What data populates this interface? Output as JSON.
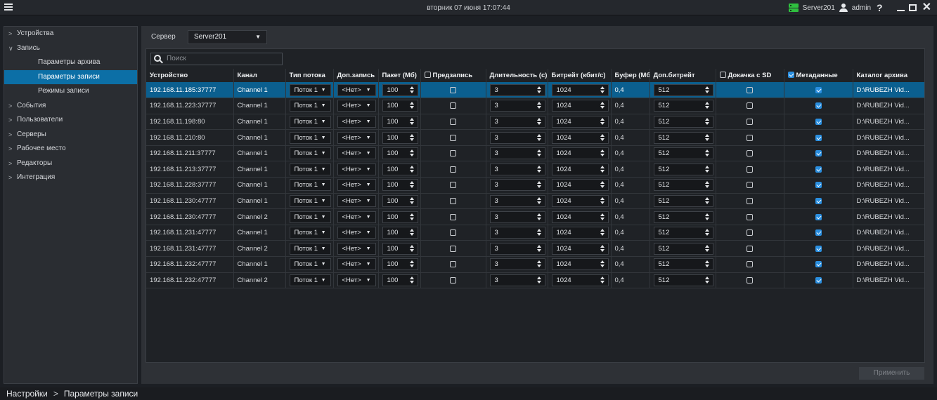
{
  "titlebar": {
    "clock": "вторник 07 июня 17:07:44",
    "server_name": "Server201",
    "user_name": "admin",
    "help_label": "?"
  },
  "sidebar": {
    "items": [
      {
        "label": "Устройства",
        "arrow": ">",
        "level": 0
      },
      {
        "label": "Запись",
        "arrow": "v",
        "level": 0
      },
      {
        "label": "Параметры архива",
        "arrow": "",
        "level": 1
      },
      {
        "label": "Параметры записи",
        "arrow": "",
        "level": 1,
        "selected": true
      },
      {
        "label": "Режимы записи",
        "arrow": "",
        "level": 1
      },
      {
        "label": "События",
        "arrow": ">",
        "level": 0
      },
      {
        "label": "Пользователи",
        "arrow": ">",
        "level": 0
      },
      {
        "label": "Серверы",
        "arrow": ">",
        "level": 0
      },
      {
        "label": "Рабочее место",
        "arrow": ">",
        "level": 0
      },
      {
        "label": "Редакторы",
        "arrow": ">",
        "level": 0
      },
      {
        "label": "Интеграция",
        "arrow": ">",
        "level": 0
      }
    ]
  },
  "main": {
    "server_label": "Сервер",
    "server_value": "Server201",
    "search_placeholder": "Поиск",
    "apply_label": "Применить"
  },
  "table": {
    "headers": {
      "device": "Устройство",
      "channel": "Канал",
      "stream_type": "Тип потока",
      "extra_record": "Доп.запись",
      "packet": "Пакет (Мб)",
      "prerecord": "Предзапись",
      "duration": "Длительность (с)",
      "bitrate": "Битрейт (кбит/с)",
      "buffer": "Буфер (Мб)",
      "extra_bitrate": "Доп.битрейт",
      "sd_download": "Докачка с SD",
      "metadata": "Метаданные",
      "archive_dir": "Каталог архива"
    },
    "header_checks": {
      "prerecord": false,
      "sd_download": false,
      "metadata": true
    },
    "rows": [
      {
        "device": "192.168.11.185:37777",
        "channel": "Channel 1",
        "stream": "Поток 1",
        "extra": "<Нет>",
        "packet": "100",
        "prerecord": false,
        "duration": "3",
        "bitrate": "1024",
        "buffer": "0,4",
        "extra_bitrate": "512",
        "sd": false,
        "meta": true,
        "dir": "D:\\RUBEZH Vid..."
      },
      {
        "device": "192.168.11.223:37777",
        "channel": "Channel 1",
        "stream": "Поток 1",
        "extra": "<Нет>",
        "packet": "100",
        "prerecord": false,
        "duration": "3",
        "bitrate": "1024",
        "buffer": "0,4",
        "extra_bitrate": "512",
        "sd": false,
        "meta": true,
        "dir": "D:\\RUBEZH Vid..."
      },
      {
        "device": "192.168.11.198:80",
        "channel": "Channel 1",
        "stream": "Поток 1",
        "extra": "<Нет>",
        "packet": "100",
        "prerecord": false,
        "duration": "3",
        "bitrate": "1024",
        "buffer": "0,4",
        "extra_bitrate": "512",
        "sd": false,
        "meta": true,
        "dir": "D:\\RUBEZH Vid..."
      },
      {
        "device": "192.168.11.210:80",
        "channel": "Channel 1",
        "stream": "Поток 1",
        "extra": "<Нет>",
        "packet": "100",
        "prerecord": false,
        "duration": "3",
        "bitrate": "1024",
        "buffer": "0,4",
        "extra_bitrate": "512",
        "sd": false,
        "meta": true,
        "dir": "D:\\RUBEZH Vid..."
      },
      {
        "device": "192.168.11.211:37777",
        "channel": "Channel 1",
        "stream": "Поток 1",
        "extra": "<Нет>",
        "packet": "100",
        "prerecord": false,
        "duration": "3",
        "bitrate": "1024",
        "buffer": "0,4",
        "extra_bitrate": "512",
        "sd": false,
        "meta": true,
        "dir": "D:\\RUBEZH Vid..."
      },
      {
        "device": "192.168.11.213:37777",
        "channel": "Channel 1",
        "stream": "Поток 1",
        "extra": "<Нет>",
        "packet": "100",
        "prerecord": false,
        "duration": "3",
        "bitrate": "1024",
        "buffer": "0,4",
        "extra_bitrate": "512",
        "sd": false,
        "meta": true,
        "dir": "D:\\RUBEZH Vid..."
      },
      {
        "device": "192.168.11.228:37777",
        "channel": "Channel 1",
        "stream": "Поток 1",
        "extra": "<Нет>",
        "packet": "100",
        "prerecord": false,
        "duration": "3",
        "bitrate": "1024",
        "buffer": "0,4",
        "extra_bitrate": "512",
        "sd": false,
        "meta": true,
        "dir": "D:\\RUBEZH Vid..."
      },
      {
        "device": "192.168.11.230:47777",
        "channel": "Channel 1",
        "stream": "Поток 1",
        "extra": "<Нет>",
        "packet": "100",
        "prerecord": false,
        "duration": "3",
        "bitrate": "1024",
        "buffer": "0,4",
        "extra_bitrate": "512",
        "sd": false,
        "meta": true,
        "dir": "D:\\RUBEZH Vid..."
      },
      {
        "device": "192.168.11.230:47777",
        "channel": "Channel 2",
        "stream": "Поток 1",
        "extra": "<Нет>",
        "packet": "100",
        "prerecord": false,
        "duration": "3",
        "bitrate": "1024",
        "buffer": "0,4",
        "extra_bitrate": "512",
        "sd": false,
        "meta": true,
        "dir": "D:\\RUBEZH Vid..."
      },
      {
        "device": "192.168.11.231:47777",
        "channel": "Channel 1",
        "stream": "Поток 1",
        "extra": "<Нет>",
        "packet": "100",
        "prerecord": false,
        "duration": "3",
        "bitrate": "1024",
        "buffer": "0,4",
        "extra_bitrate": "512",
        "sd": false,
        "meta": true,
        "dir": "D:\\RUBEZH Vid..."
      },
      {
        "device": "192.168.11.231:47777",
        "channel": "Channel 2",
        "stream": "Поток 1",
        "extra": "<Нет>",
        "packet": "100",
        "prerecord": false,
        "duration": "3",
        "bitrate": "1024",
        "buffer": "0,4",
        "extra_bitrate": "512",
        "sd": false,
        "meta": true,
        "dir": "D:\\RUBEZH Vid..."
      },
      {
        "device": "192.168.11.232:47777",
        "channel": "Channel 1",
        "stream": "Поток 1",
        "extra": "<Нет>",
        "packet": "100",
        "prerecord": false,
        "duration": "3",
        "bitrate": "1024",
        "buffer": "0,4",
        "extra_bitrate": "512",
        "sd": false,
        "meta": true,
        "dir": "D:\\RUBEZH Vid..."
      },
      {
        "device": "192.168.11.232:47777",
        "channel": "Channel 2",
        "stream": "Поток 1",
        "extra": "<Нет>",
        "packet": "100",
        "prerecord": false,
        "duration": "3",
        "bitrate": "1024",
        "buffer": "0,4",
        "extra_bitrate": "512",
        "sd": false,
        "meta": true,
        "dir": "D:\\RUBEZH Vid..."
      }
    ],
    "selected_row": 0
  },
  "statusbar": {
    "crumbs": [
      "Настройки",
      "Параметры записи"
    ],
    "separator": ">"
  },
  "colors": {
    "accent": "#0c6fa6",
    "selected_row": "#0b5f8f",
    "server_ok": "#2fbf3f",
    "checkbox_on": "#2a8fe0"
  },
  "icons": {
    "menu": "hamburger-icon",
    "server": "server-status-icon",
    "user": "user-icon",
    "help": "help-icon",
    "search": "search-icon"
  }
}
